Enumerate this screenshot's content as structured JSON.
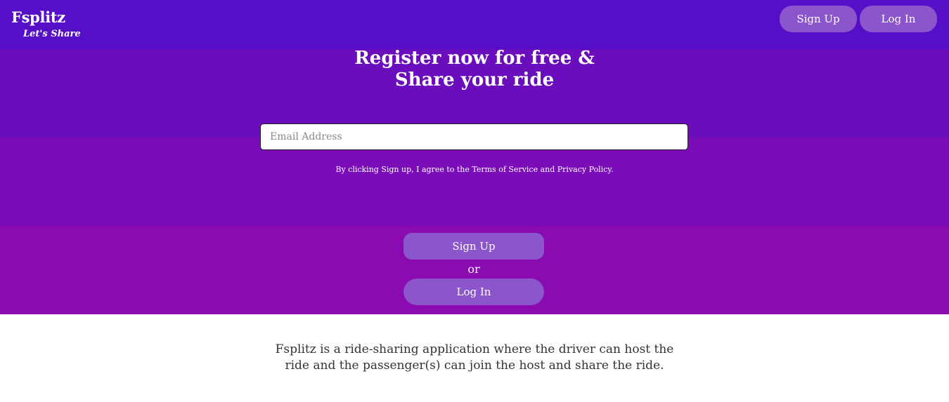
{
  "brand": {
    "name": "Fsplitz",
    "tagline": "Let's Share"
  },
  "nav": {
    "signup_label": "Sign Up",
    "login_label": "Log In"
  },
  "hero": {
    "headline_line1": "Register now for free &",
    "headline_line2": "Share your ride",
    "email_placeholder": "Email Address",
    "email_value": "",
    "terms_text": "By clicking Sign up, I agree to the Terms of Service and Privacy Policy.",
    "signup_label": "Sign Up",
    "or_text": "or",
    "login_label": "Log In"
  },
  "about": {
    "line1": "Fsplitz is a ride-sharing application where the driver can host the",
    "line2": "ride and the passenger(s) can join the host and share the ride."
  },
  "colors": {
    "hero_top": "#560ec6",
    "hero_bottom": "#8a0bb0",
    "button": "#8b55cc",
    "text_dark": "#333333"
  }
}
